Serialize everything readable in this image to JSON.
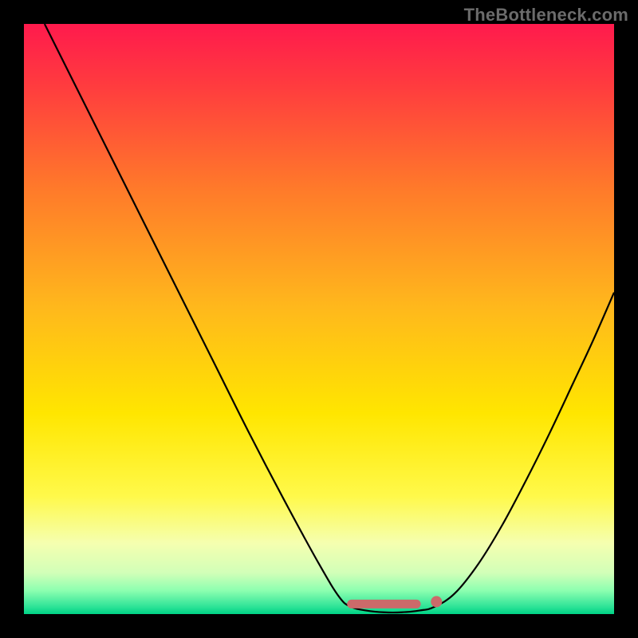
{
  "watermark": "TheBottleneck.com",
  "colors": {
    "curve": "#000000",
    "marker": "#cc6a6a"
  },
  "chart_data": {
    "type": "line",
    "title": "",
    "xlabel": "",
    "ylabel": "",
    "xlim": [
      0,
      1
    ],
    "ylim": [
      0,
      1
    ],
    "series": [
      {
        "name": "left-curve",
        "x": [
          0.035,
          0.08,
          0.14,
          0.2,
          0.26,
          0.32,
          0.38,
          0.44,
          0.5,
          0.535,
          0.555
        ],
        "y": [
          1.0,
          0.91,
          0.79,
          0.67,
          0.55,
          0.43,
          0.31,
          0.195,
          0.085,
          0.028,
          0.012
        ]
      },
      {
        "name": "trough",
        "x": [
          0.555,
          0.58,
          0.61,
          0.64,
          0.67,
          0.695
        ],
        "y": [
          0.012,
          0.006,
          0.003,
          0.003,
          0.006,
          0.012
        ]
      },
      {
        "name": "right-curve",
        "x": [
          0.695,
          0.73,
          0.77,
          0.81,
          0.85,
          0.89,
          0.93,
          0.965,
          1.0
        ],
        "y": [
          0.012,
          0.035,
          0.085,
          0.15,
          0.225,
          0.305,
          0.39,
          0.465,
          0.545
        ]
      }
    ],
    "markers": {
      "flat_segment": {
        "x": [
          0.555,
          0.665
        ],
        "y": 0.017
      },
      "dot": {
        "x": 0.699,
        "y": 0.021,
        "r": 0.0095
      }
    }
  }
}
